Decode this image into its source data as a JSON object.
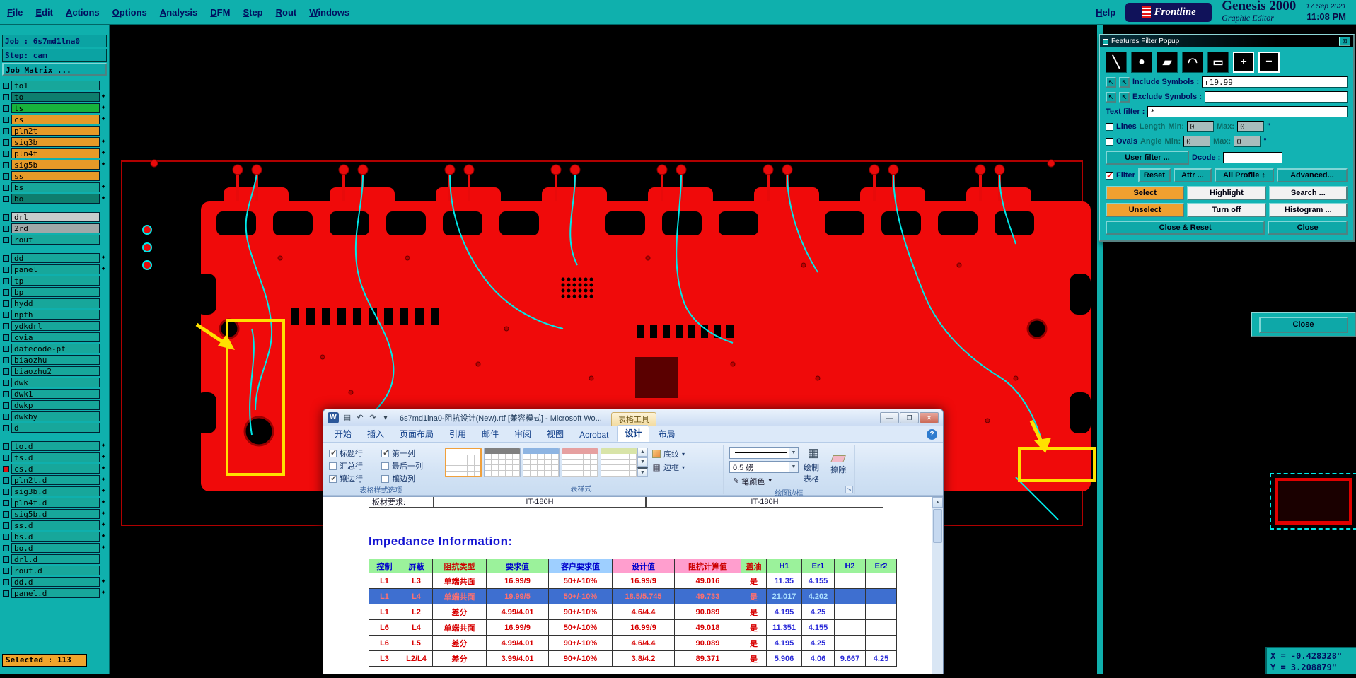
{
  "colors": {
    "teal": "#0FB0AD",
    "board_red": "#F00A0A",
    "trace_cyan": "#00E8E8",
    "highlight_yellow": "#FFE000",
    "layer_orange": "#E79A28",
    "selected_row_blue": "#3E6FD0"
  },
  "menu_bar": {
    "items": [
      "File",
      "Edit",
      "Actions",
      "Options",
      "Analysis",
      "DFM",
      "Step",
      "Rout",
      "Windows"
    ],
    "help": "Help",
    "brand": "Frontline",
    "product": "Genesis 2000",
    "date": "17 Sep 2021",
    "time": "11:08 PM",
    "subtitle": "Graphic Editor"
  },
  "sidebar": {
    "job_label": "Job : 6s7md1lna0",
    "step_label": "Step: cam",
    "matrix_button": "Job Matrix ...",
    "selected_label": "Selected : 113",
    "layer_groups": [
      {
        "layers": [
          {
            "name": "to1",
            "color": "teal",
            "marker": false
          },
          {
            "name": "to",
            "color": "dkgreen",
            "marker": true
          },
          {
            "name": "ts",
            "color": "green",
            "marker": true
          },
          {
            "name": "cs",
            "color": "orange",
            "marker": true
          },
          {
            "name": "pln2t",
            "color": "orange",
            "marker": false
          },
          {
            "name": "sig3b",
            "color": "orange",
            "marker": true
          },
          {
            "name": "pln4t",
            "color": "orange",
            "marker": true
          },
          {
            "name": "sig5b",
            "color": "orange",
            "marker": true
          },
          {
            "name": "ss",
            "color": "orange",
            "marker": false
          },
          {
            "name": "bs",
            "color": "teal",
            "marker": true
          },
          {
            "name": "bo",
            "color": "dkgreen",
            "marker": true
          }
        ]
      },
      {
        "layers": [
          {
            "name": "drl",
            "color": "silver",
            "marker": false
          },
          {
            "name": "2rd",
            "color": "gray",
            "marker": false
          },
          {
            "name": "rout",
            "color": "teal",
            "marker": false
          }
        ]
      },
      {
        "layers": [
          {
            "name": "dd",
            "color": "teal",
            "marker": true
          },
          {
            "name": "panel",
            "color": "teal",
            "marker": true
          },
          {
            "name": "tp",
            "color": "teal",
            "marker": false
          },
          {
            "name": "bp",
            "color": "teal",
            "marker": false
          },
          {
            "name": "hydd",
            "color": "teal",
            "marker": false
          },
          {
            "name": "npth",
            "color": "teal",
            "marker": false
          },
          {
            "name": "ydkdrl",
            "color": "teal",
            "marker": false
          },
          {
            "name": "cvia",
            "color": "teal",
            "marker": false
          },
          {
            "name": "datecode-pt",
            "color": "teal",
            "marker": false
          },
          {
            "name": "biaozhu",
            "color": "teal",
            "marker": false
          },
          {
            "name": "biaozhu2",
            "color": "teal",
            "marker": false
          },
          {
            "name": "dwk",
            "color": "teal",
            "marker": false
          },
          {
            "name": "dwk1",
            "color": "teal",
            "marker": false
          },
          {
            "name": "dwkp",
            "color": "teal",
            "marker": false
          },
          {
            "name": "dwkby",
            "color": "teal",
            "marker": false
          },
          {
            "name": "d",
            "color": "teal",
            "marker": false
          }
        ]
      },
      {
        "layers": [
          {
            "name": "to.d",
            "color": "teal",
            "marker": true
          },
          {
            "name": "ts.d",
            "color": "teal",
            "marker": true
          },
          {
            "name": "cs.d",
            "color": "teal",
            "marker": true,
            "special": true
          },
          {
            "name": "pln2t.d",
            "color": "teal",
            "marker": true
          },
          {
            "name": "sig3b.d",
            "color": "teal",
            "marker": true
          },
          {
            "name": "pln4t.d",
            "color": "teal",
            "marker": true
          },
          {
            "name": "sig5b.d",
            "color": "teal",
            "marker": true
          },
          {
            "name": "ss.d",
            "color": "teal",
            "marker": true
          },
          {
            "name": "bs.d",
            "color": "teal",
            "marker": true
          },
          {
            "name": "bo.d",
            "color": "teal",
            "marker": true
          },
          {
            "name": "drl.d",
            "color": "teal",
            "marker": false
          },
          {
            "name": "rout.d",
            "color": "teal",
            "marker": false
          },
          {
            "name": "dd.d",
            "color": "teal",
            "marker": true
          },
          {
            "name": "panel.d",
            "color": "teal",
            "marker": true
          }
        ]
      }
    ]
  },
  "filter_popup": {
    "title": "Features Filter Popup",
    "tools": [
      "line-tool",
      "pad-tool",
      "surface-tool",
      "arc-tool",
      "rect-tool",
      "zoom-in-tool",
      "zoom-out-tool"
    ],
    "include_label": "Include Symbols :",
    "include_value": "r19.99",
    "exclude_label": "Exclude Symbols :",
    "exclude_value": "",
    "text_filter_label": "Text filter :",
    "text_filter_value": "*",
    "lines_row": {
      "label": "Lines",
      "dim_label": "Length",
      "min_label": "Min:",
      "min": "0",
      "max_label": "Max:",
      "max": "0",
      "unit": "\""
    },
    "ovals_row": {
      "label": "Ovals",
      "dim_label": "Angle",
      "min_label": "Min:",
      "min": "0",
      "max_label": "Max:",
      "max": "0",
      "unit": "°"
    },
    "user_filter": "User filter ...",
    "dcode_label": "Dcode :",
    "dcode_value": "",
    "filter_check": "Filter",
    "reset": "Reset",
    "attr": "Attr ...",
    "profile": "All Profile",
    "advanced": "Advanced...",
    "select": "Select",
    "highlight": "Highlight",
    "search": "Search ...",
    "unselect": "Unselect",
    "turn_off": "Turn off",
    "histogram": "Histogram ...",
    "close_reset": "Close & Reset",
    "close": "Close"
  },
  "close_panel": {
    "close": "Close"
  },
  "coords": {
    "x": "X = -0.428328\"",
    "y": "Y = 3.208879\""
  },
  "word": {
    "title": "6s7md1lna0-阻抗设计(New).rtf [兼容模式] - Microsoft Wo...",
    "context_tab": "表格工具",
    "tabs": [
      {
        "label": "开始",
        "active": false
      },
      {
        "label": "插入",
        "active": false
      },
      {
        "label": "页面布局",
        "active": false
      },
      {
        "label": "引用",
        "active": false
      },
      {
        "label": "邮件",
        "active": false
      },
      {
        "label": "审阅",
        "active": false
      },
      {
        "label": "视图",
        "active": false
      },
      {
        "label": "Acrobat",
        "active": false
      },
      {
        "label": "设计",
        "active": true
      },
      {
        "label": "布局",
        "active": false
      }
    ],
    "style_options": {
      "label": "表格样式选项",
      "checks": [
        {
          "label": "标题行",
          "checked": true
        },
        {
          "label": "第一列",
          "checked": true
        },
        {
          "label": "汇总行",
          "checked": false
        },
        {
          "label": "最后一列",
          "checked": false
        },
        {
          "label": "镶边行",
          "checked": true
        },
        {
          "label": "镶边列",
          "checked": false
        }
      ]
    },
    "table_styles": {
      "label": "表样式",
      "thumbs": [
        {
          "name": "plain-grid",
          "header": "#FFFFFF",
          "selected": true
        },
        {
          "name": "gray-header",
          "header": "#808080",
          "selected": false
        },
        {
          "name": "light-blue",
          "header": "#8DB4E2",
          "selected": false
        },
        {
          "name": "light-red",
          "header": "#E6A0A0",
          "selected": false
        },
        {
          "name": "light-green",
          "header": "#D8E4A8",
          "selected": false
        }
      ],
      "shading": "底纹",
      "borders": "边框"
    },
    "draw_borders": {
      "label": "绘图边框",
      "weight": "0.5 磅",
      "pen_color": "笔颜色",
      "draw_table": "绘制表格",
      "eraser": "擦除"
    },
    "doc": {
      "top_row": [
        "板材要求:",
        "IT-180H",
        "IT-180H"
      ],
      "heading": "Impedance Information:",
      "table": {
        "headers": [
          {
            "label": "控制",
            "bg": "#9BF29B",
            "fg": "#0000CC"
          },
          {
            "label": "屏蔽",
            "bg": "#9BF29B",
            "fg": "#0000CC"
          },
          {
            "label": "阻抗类型",
            "bg": "#9BF29B",
            "fg": "#CC0000"
          },
          {
            "label": "要求值",
            "bg": "#9BF29B",
            "fg": "#0000CC"
          },
          {
            "label": "客户要求值",
            "bg": "#9ECFFF",
            "fg": "#0000CC"
          },
          {
            "label": "设计值",
            "bg": "#FF9ECE",
            "fg": "#0000CC"
          },
          {
            "label": "阻抗计算值",
            "bg": "#FF9ECE",
            "fg": "#CC0000"
          },
          {
            "label": "盖油",
            "bg": "#9BF29B",
            "fg": "#CC0000"
          },
          {
            "label": "H1",
            "bg": "#9BF29B",
            "fg": "#0000CC"
          },
          {
            "label": "Er1",
            "bg": "#9BF29B",
            "fg": "#0000CC"
          },
          {
            "label": "H2",
            "bg": "#9BF29B",
            "fg": "#0000CC"
          },
          {
            "label": "Er2",
            "bg": "#9BF29B",
            "fg": "#0000CC"
          }
        ],
        "rows": [
          {
            "selected": false,
            "cells": [
              "L1",
              "L3",
              "单端共面",
              "16.99/9",
              "50+/-10%",
              "16.99/9",
              "49.016",
              "是",
              "11.35",
              "4.155",
              "",
              ""
            ]
          },
          {
            "selected": true,
            "cells": [
              "L1",
              "L4",
              "单端共面",
              "19.99/5",
              "50+/-10%",
              "18.5/5.745",
              "49.733",
              "是",
              "21.017",
              "4.202",
              "",
              ""
            ]
          },
          {
            "selected": false,
            "cells": [
              "L1",
              "L2",
              "差分",
              "4.99/4.01",
              "90+/-10%",
              "4.6/4.4",
              "90.089",
              "是",
              "4.195",
              "4.25",
              "",
              ""
            ]
          },
          {
            "selected": false,
            "cells": [
              "L6",
              "L4",
              "单端共面",
              "16.99/9",
              "50+/-10%",
              "16.99/9",
              "49.018",
              "是",
              "11.351",
              "4.155",
              "",
              ""
            ]
          },
          {
            "selected": false,
            "cells": [
              "L6",
              "L5",
              "差分",
              "4.99/4.01",
              "90+/-10%",
              "4.6/4.4",
              "90.089",
              "是",
              "4.195",
              "4.25",
              "",
              ""
            ]
          },
          {
            "selected": false,
            "cells": [
              "L3",
              "L2/L4",
              "差分",
              "3.99/4.01",
              "90+/-10%",
              "3.8/4.2",
              "89.371",
              "是",
              "5.906",
              "4.06",
              "9.667",
              "4.25"
            ]
          }
        ]
      }
    }
  }
}
